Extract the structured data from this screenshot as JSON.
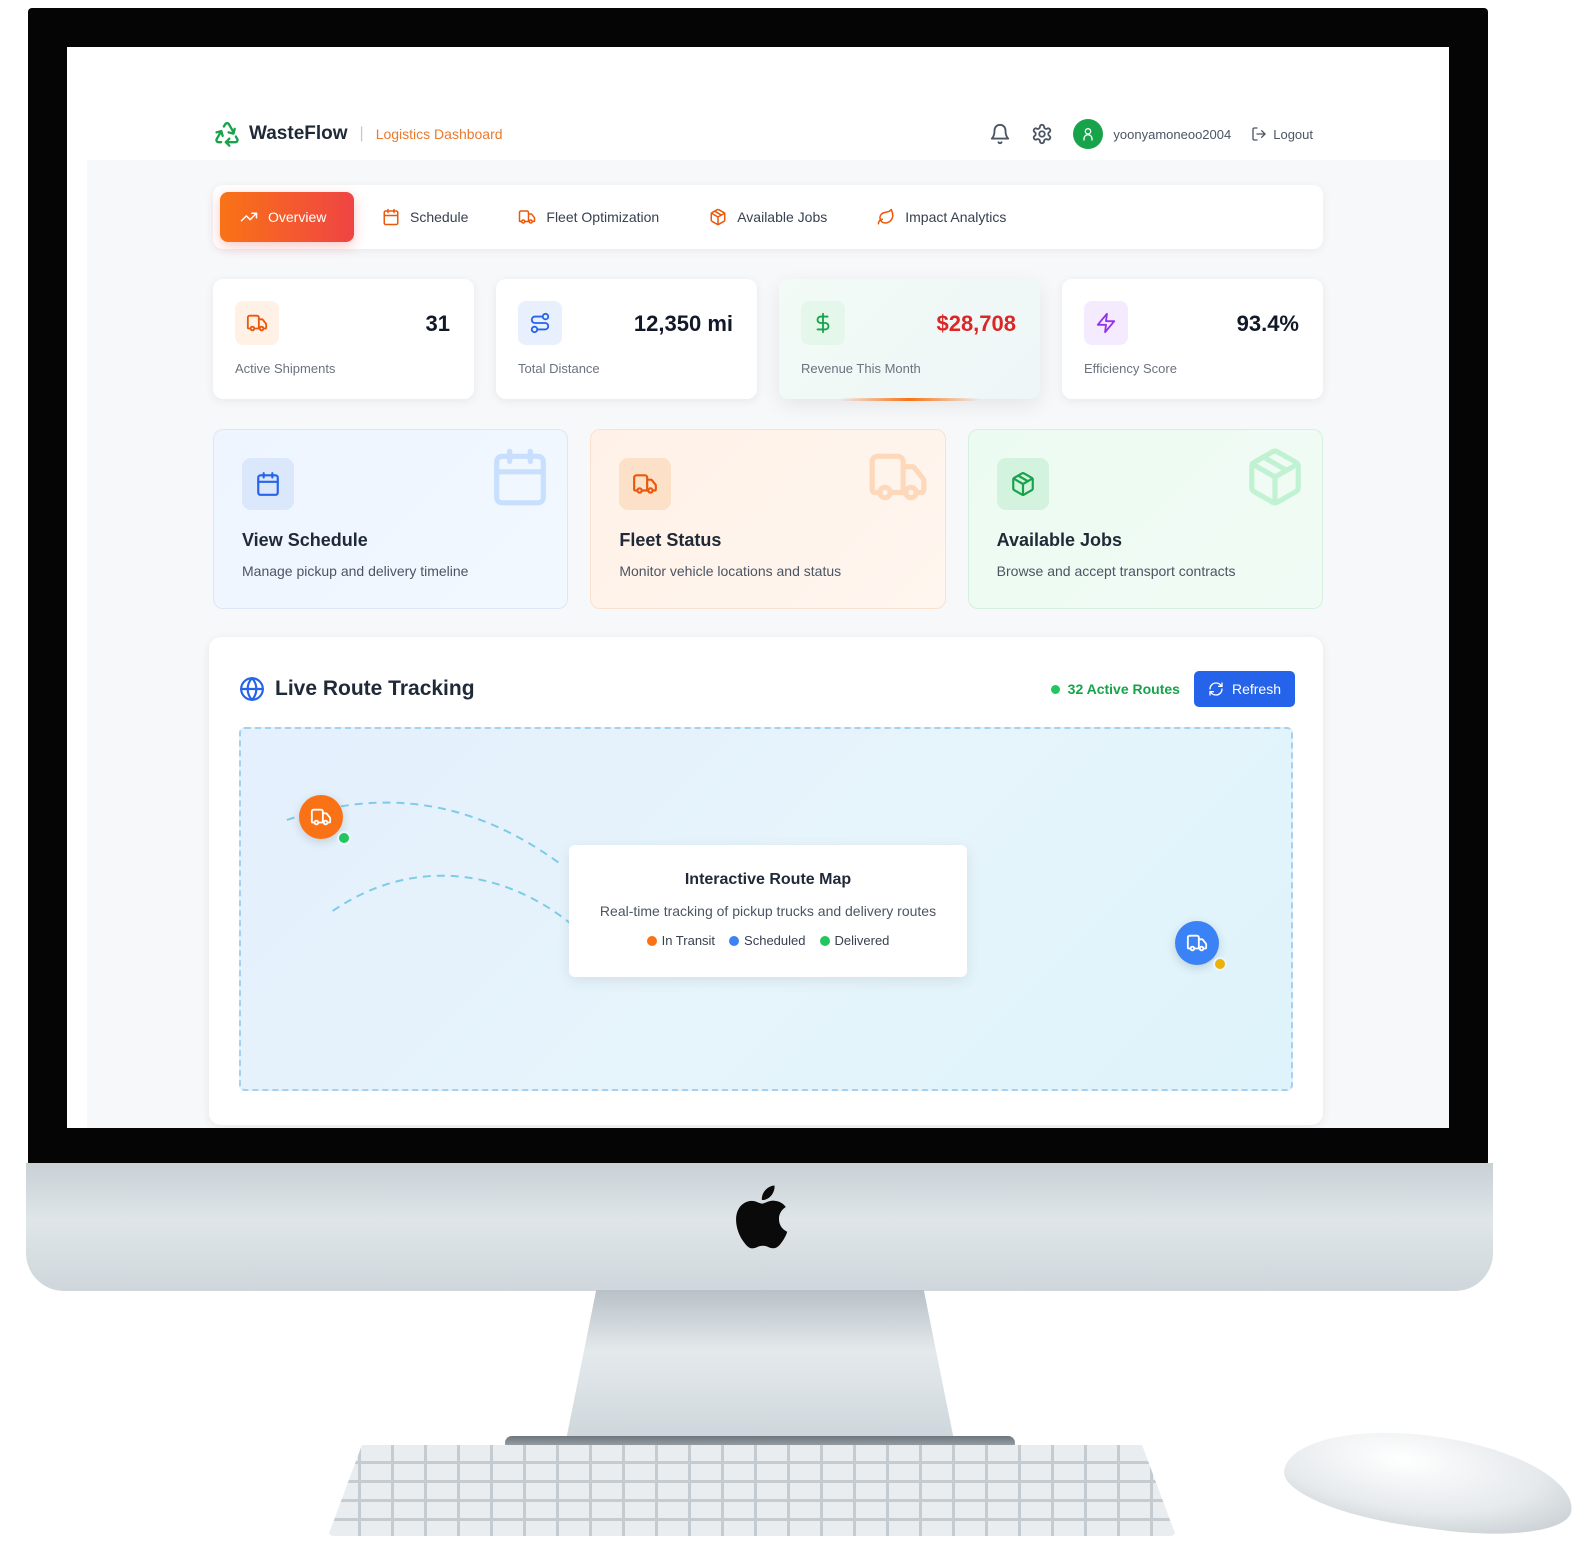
{
  "header": {
    "brand_name": "WasteFlow",
    "brand_separator": "|",
    "brand_subtitle": "Logistics Dashboard",
    "brand_icon": "recycle-icon",
    "username": "yoonyamoneoo2004",
    "logout_label": "Logout"
  },
  "tabs": [
    {
      "label": "Overview",
      "icon": "trend-up-icon",
      "active": true
    },
    {
      "label": "Schedule",
      "icon": "calendar-icon",
      "active": false
    },
    {
      "label": "Fleet Optimization",
      "icon": "truck-icon",
      "active": false
    },
    {
      "label": "Available Jobs",
      "icon": "package-icon",
      "active": false
    },
    {
      "label": "Impact Analytics",
      "icon": "leaf-icon",
      "active": false
    }
  ],
  "stats": [
    {
      "value": "31",
      "label": "Active Shipments",
      "icon": "truck-icon",
      "color": "#ea580c"
    },
    {
      "value": "12,350 mi",
      "label": "Total Distance",
      "icon": "route-icon",
      "color": "#2563eb"
    },
    {
      "value": "$28,708",
      "label": "Revenue This Month",
      "icon": "dollar-icon",
      "color": "#dc2626"
    },
    {
      "value": "93.4%",
      "label": "Efficiency Score",
      "icon": "lightning-icon",
      "color": "#9333ea"
    }
  ],
  "quick_cards": [
    {
      "title": "View Schedule",
      "description": "Manage pickup and delivery timeline",
      "icon": "calendar-icon"
    },
    {
      "title": "Fleet Status",
      "description": "Monitor vehicle locations and status",
      "icon": "truck-icon"
    },
    {
      "title": "Available Jobs",
      "description": "Browse and accept transport contracts",
      "icon": "package-icon"
    }
  ],
  "tracking": {
    "title": "Live Route Tracking",
    "active_routes": "32 Active Routes",
    "refresh_label": "Refresh",
    "map_title": "Interactive Route Map",
    "map_subtitle": "Real-time tracking of pickup trucks and delivery routes",
    "legend": [
      {
        "label": "In Transit",
        "color": "#f97316"
      },
      {
        "label": "Scheduled",
        "color": "#3b82f6"
      },
      {
        "label": "Delivered",
        "color": "#22c55e"
      }
    ]
  },
  "colors": {
    "accent_orange": "#f97316",
    "accent_red": "#ef4444",
    "primary_blue": "#2563eb",
    "success_green": "#16a34a"
  }
}
